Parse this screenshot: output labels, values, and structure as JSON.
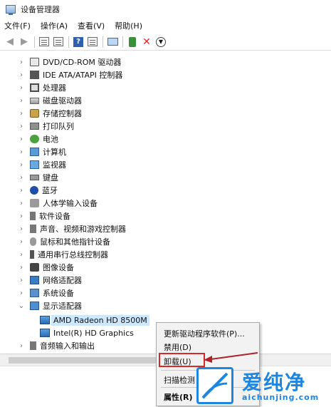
{
  "window": {
    "title": "设备管理器"
  },
  "menu": [
    {
      "name": "menu-file",
      "label": "文件(F)"
    },
    {
      "name": "menu-action",
      "label": "操作(A)"
    },
    {
      "name": "menu-view",
      "label": "查看(V)"
    },
    {
      "name": "menu-help",
      "label": "帮助(H)"
    }
  ],
  "toolbar": {
    "icons": [
      "back-arrow-icon",
      "forward-arrow-icon",
      "properties-icon",
      "update-driver-icon",
      "help-icon",
      "view-icon",
      "scan-hardware-icon",
      "enable-device-icon",
      "uninstall-x-icon",
      "download-icon"
    ]
  },
  "tree": {
    "categories": [
      {
        "label": "DVD/CD-ROM 驱动器",
        "icon": "disc-drive-icon",
        "expanded": false
      },
      {
        "label": "IDE ATA/ATAPI 控制器",
        "icon": "ide-controller-icon",
        "expanded": false
      },
      {
        "label": "处理器",
        "icon": "processor-icon",
        "expanded": false
      },
      {
        "label": "磁盘驱动器",
        "icon": "disk-drive-icon",
        "expanded": false
      },
      {
        "label": "存储控制器",
        "icon": "storage-controller-icon",
        "expanded": false
      },
      {
        "label": "打印队列",
        "icon": "printer-icon",
        "expanded": false
      },
      {
        "label": "电池",
        "icon": "battery-icon",
        "expanded": false
      },
      {
        "label": "计算机",
        "icon": "computer-icon",
        "expanded": false
      },
      {
        "label": "监视器",
        "icon": "monitor-icon",
        "expanded": false
      },
      {
        "label": "键盘",
        "icon": "keyboard-icon",
        "expanded": false
      },
      {
        "label": "蓝牙",
        "icon": "bluetooth-icon",
        "expanded": false
      },
      {
        "label": "人体学输入设备",
        "icon": "hid-icon",
        "expanded": false
      },
      {
        "label": "软件设备",
        "icon": "software-device-icon",
        "expanded": false
      },
      {
        "label": "声音、视频和游戏控制器",
        "icon": "audio-icon",
        "expanded": false
      },
      {
        "label": "鼠标和其他指针设备",
        "icon": "mouse-icon",
        "expanded": false
      },
      {
        "label": "通用串行总线控制器",
        "icon": "usb-icon",
        "expanded": false
      },
      {
        "label": "图像设备",
        "icon": "camera-icon",
        "expanded": false
      },
      {
        "label": "网络适配器",
        "icon": "network-adapter-icon",
        "expanded": false
      },
      {
        "label": "系统设备",
        "icon": "system-device-icon",
        "expanded": false
      },
      {
        "label": "显示适配器",
        "icon": "display-adapter-icon",
        "expanded": true
      }
    ],
    "display_children": [
      {
        "label": "AMD Radeon HD 8500M",
        "icon": "gpu-icon",
        "selected": true
      },
      {
        "label": "Intel(R) HD Graphics",
        "icon": "gpu-icon",
        "selected": false
      }
    ],
    "last_category": {
      "label": "音频输入和输出",
      "icon": "audio-io-icon",
      "expanded": false
    }
  },
  "context_menu": {
    "items": [
      {
        "label": "更新驱动程序软件(P)...",
        "bold": false
      },
      {
        "label": "禁用(D)",
        "bold": false
      },
      {
        "label": "卸载(U)",
        "bold": false,
        "highlighted": true
      },
      {
        "label": "扫描检测",
        "bold": false
      },
      {
        "label": "属性(R)",
        "bold": true
      }
    ]
  },
  "watermark": {
    "brand": "爱纯净",
    "url": "aichunjing.com"
  },
  "colors": {
    "highlight_border": "#d8282a",
    "selection": "#cce8ff",
    "watermark_blue": "#1f86e0",
    "arrow": "#b0222a"
  }
}
